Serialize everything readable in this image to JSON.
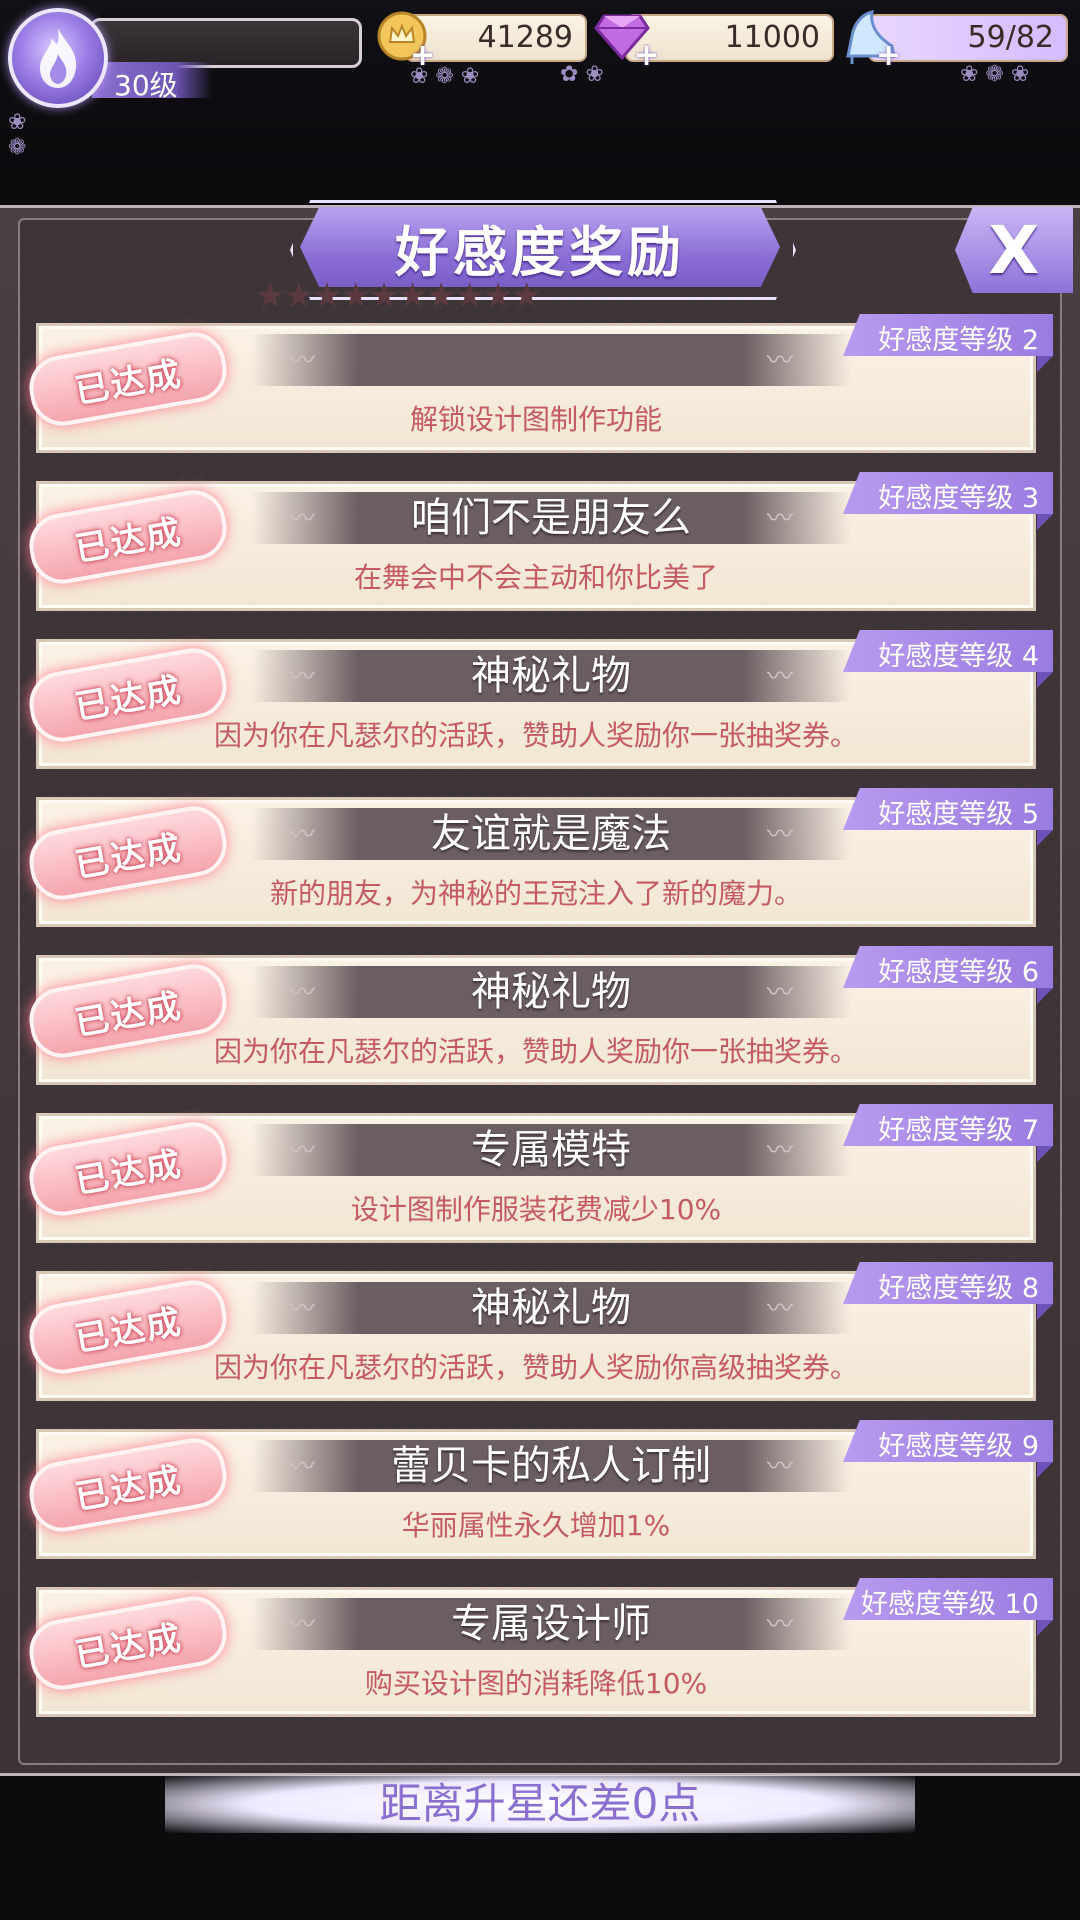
{
  "hud": {
    "player_level": "30级",
    "gold": "41289",
    "diamonds": "11000",
    "energy": "59/82",
    "plus": "+",
    "colors": {
      "accent": "#9b7de6",
      "gold": "#e6b84a",
      "diamond": "#b04fd6"
    }
  },
  "panel": {
    "title": "好感度奖励",
    "close_label": "X"
  },
  "rewards": [
    {
      "status": "已达成",
      "level_tag": "好感度等级 2",
      "title": "",
      "desc": "解锁设计图制作功能"
    },
    {
      "status": "已达成",
      "level_tag": "好感度等级 3",
      "title": "咱们不是朋友么",
      "desc": "在舞会中不会主动和你比美了"
    },
    {
      "status": "已达成",
      "level_tag": "好感度等级 4",
      "title": "神秘礼物",
      "desc": "因为你在凡瑟尔的活跃，赞助人奖励你一张抽奖券。"
    },
    {
      "status": "已达成",
      "level_tag": "好感度等级 5",
      "title": "友谊就是魔法",
      "desc": "新的朋友，为神秘的王冠注入了新的魔力。"
    },
    {
      "status": "已达成",
      "level_tag": "好感度等级 6",
      "title": "神秘礼物",
      "desc": "因为你在凡瑟尔的活跃，赞助人奖励你一张抽奖券。"
    },
    {
      "status": "已达成",
      "level_tag": "好感度等级 7",
      "title": "专属模特",
      "desc": "设计图制作服装花费减少10%"
    },
    {
      "status": "已达成",
      "level_tag": "好感度等级 8",
      "title": "神秘礼物",
      "desc": "因为你在凡瑟尔的活跃，赞助人奖励你高级抽奖券。"
    },
    {
      "status": "已达成",
      "level_tag": "好感度等级 9",
      "title": "蕾贝卡的私人订制",
      "desc": "华丽属性永久增加1%"
    },
    {
      "status": "已达成",
      "level_tag": "好感度等级 10",
      "title": "专属设计师",
      "desc": "购买设计图的消耗降低10%"
    }
  ],
  "footer": {
    "text": "距离升星还差0点"
  }
}
